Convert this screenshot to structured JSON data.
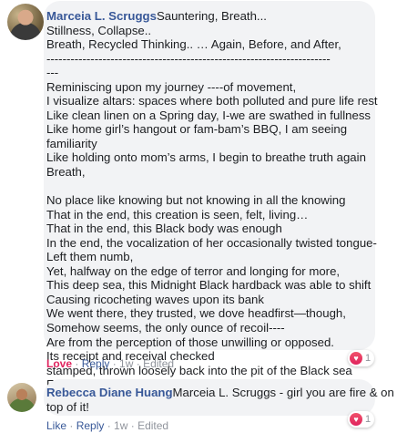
{
  "comment1": {
    "author": "Marceia L. Scruggs",
    "text": "Sauntering, Breath...\nStillness, Collapse..\nBreath, Recycled Thinking.. … Again, Before, and After,\n-----------------------------------------------------------------------\n---\nReminiscing upon my journey ----of movement,\nI visualize altars: spaces where both polluted and pure life rest\nLike clean linen on a Spring day, I-we are swathed in fullness\nLike home girl’s hangout or fam-bam’s BBQ, I am seeing\nfamiliarity\nLike holding onto mom’s arms, I begin to breathe truth again\nBreath,\n\nNo place like knowing but not knowing in all the knowing\nThat in the end, this creation is seen, felt, living…\nThat in the end, this Black body was enough\nIn the end, the vocalization of her occasionally twisted tongue-\nLeft them numb,\nYet, halfway on the edge of terror and longing for more,\nThis deep sea, this Midnight Black hardback was able to shift\nCausing ricocheting waves upon its bank\nWe went there, they trusted, we dove headfirst—though,\nSomehow seems, the only ounce of recoil----\nAre from the perception of those unwilling or opposed.\nIts receipt and receival checked\nstamped, thrown loosely back into the pit of the Black sea\nFar from arms reach yet, close enough to find latch.",
    "reacted": "Love",
    "reply": "Reply",
    "sep": " · ",
    "time": "1w",
    "edited": "Edited",
    "reaction_count": "1"
  },
  "comment2": {
    "author": "Rebecca Diane Huang",
    "text": "Marceia L. Scruggs - girl you are fire & on\ntop of it!",
    "like": "Like",
    "reply": "Reply",
    "sep": " · ",
    "time": "1w",
    "edited": "Edited",
    "reaction_count": "1"
  },
  "icons": {
    "reaction": "heart-icon",
    "avatar": "avatar"
  },
  "colors": {
    "link": "#385898",
    "love": "#e0245e",
    "bubble": "#f2f3f5",
    "meta": "#90949c"
  }
}
